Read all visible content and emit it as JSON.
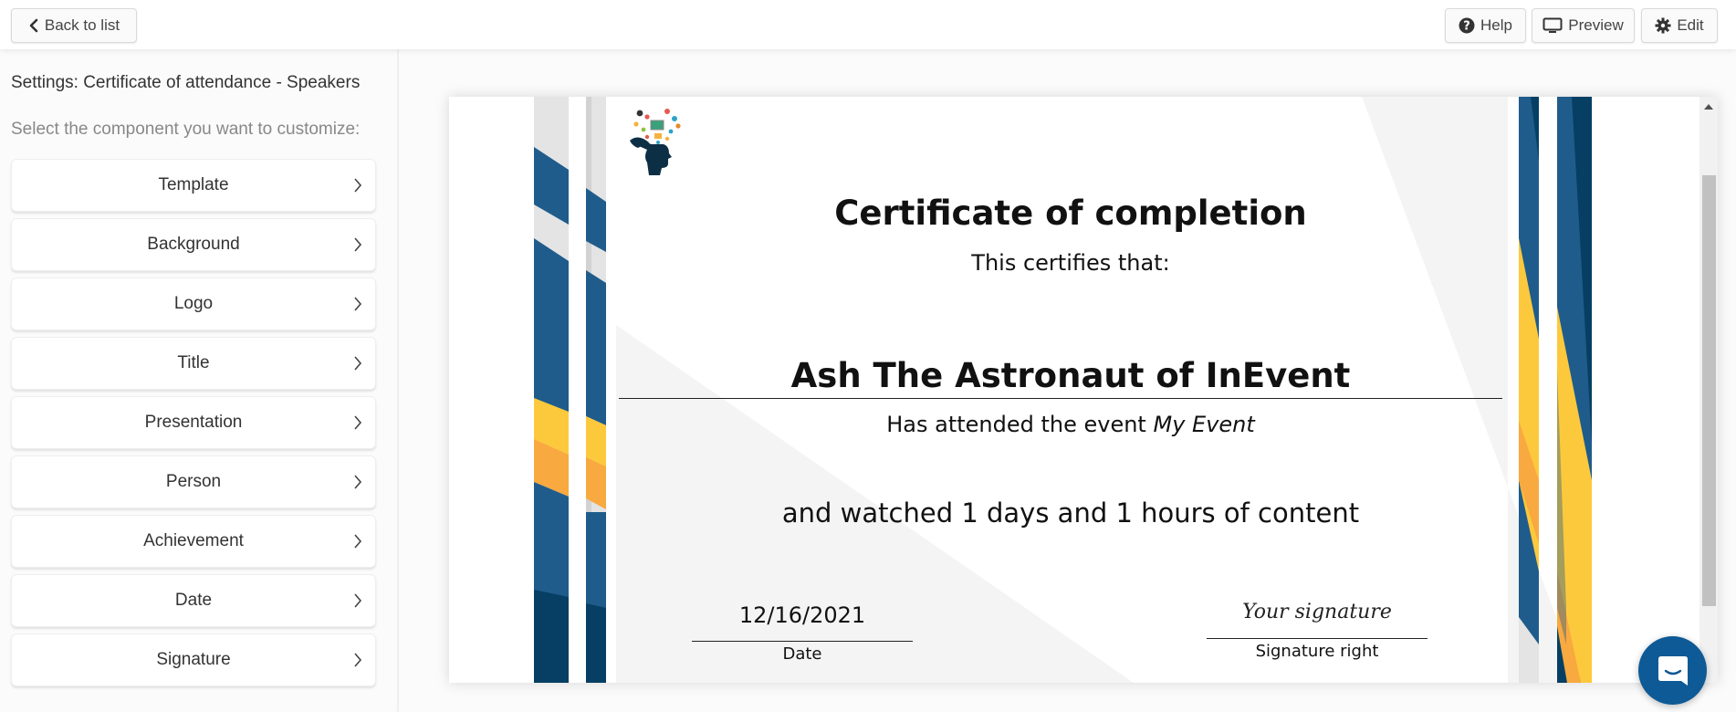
{
  "header": {
    "back_label": "Back to list",
    "help_label": "Help",
    "preview_label": "Preview",
    "edit_label": "Edit"
  },
  "sidebar": {
    "title": "Settings: Certificate of attendance - Speakers",
    "subtitle": "Select the component you want to customize:",
    "items": [
      {
        "label": "Template"
      },
      {
        "label": "Background"
      },
      {
        "label": "Logo"
      },
      {
        "label": "Title"
      },
      {
        "label": "Presentation"
      },
      {
        "label": "Person"
      },
      {
        "label": "Achievement"
      },
      {
        "label": "Date"
      },
      {
        "label": "Signature"
      }
    ]
  },
  "certificate": {
    "title": "Certificate of completion",
    "certifies": "This certifies that:",
    "name": "Ash The Astronaut of InEvent",
    "attended_prefix": "Has attended the event ",
    "event_name": "My Event",
    "watched": "and watched 1 days and 1 hours of content",
    "date_value": "12/16/2021",
    "date_label": "Date",
    "signature_value": "Your signature",
    "signature_label": "Signature right"
  },
  "colors": {
    "stripe_blue": "#1f5c8b",
    "stripe_dark_blue": "#063f63",
    "stripe_yellow": "#fdc93c",
    "stripe_orange": "#f8a93f",
    "stripe_grey": "#e4e4e4",
    "chat_blue": "#0e5a96"
  }
}
